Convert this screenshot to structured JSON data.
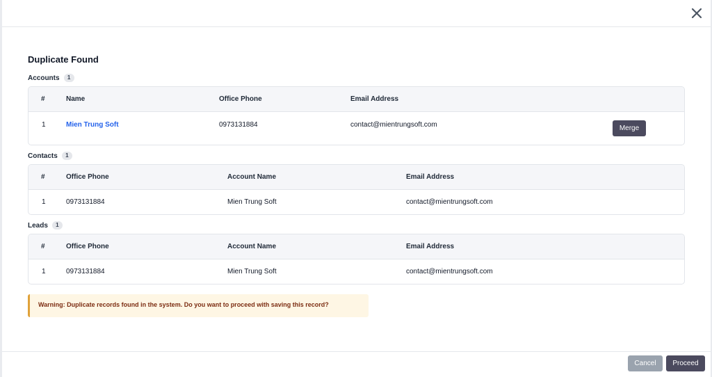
{
  "modal": {
    "title": "Duplicate Found",
    "close_icon": "close-icon"
  },
  "accounts": {
    "label": "Accounts",
    "count": "1",
    "headers": [
      "#",
      "Name",
      "Office Phone",
      "Email Address"
    ],
    "rows": [
      {
        "num": "1",
        "name": "Mien Trung Soft",
        "office_phone": "0973131884",
        "email": "contact@mientrungsoft.com",
        "action_label": "Merge"
      }
    ]
  },
  "contacts": {
    "label": "Contacts",
    "count": "1",
    "headers": [
      "#",
      "Office Phone",
      "Account Name",
      "Email Address"
    ],
    "rows": [
      {
        "num": "1",
        "office_phone": "0973131884",
        "account_name": "Mien Trung Soft",
        "email": "contact@mientrungsoft.com"
      }
    ]
  },
  "leads": {
    "label": "Leads",
    "count": "1",
    "headers": [
      "#",
      "Office Phone",
      "Account Name",
      "Email Address"
    ],
    "rows": [
      {
        "num": "1",
        "office_phone": "0973131884",
        "account_name": "Mien Trung Soft",
        "email": "contact@mientrungsoft.com"
      }
    ]
  },
  "warning": {
    "text": "Warning: Duplicate records found in the system. Do you want to proceed with saving this record?"
  },
  "footer": {
    "cancel_label": "Cancel",
    "proceed_label": "Proceed"
  },
  "colors": {
    "primary_button": "#4b4a5e",
    "cancel_button": "#9aa3ae",
    "link": "#2563eb",
    "warning_bg": "#fef6e4",
    "warning_border": "#e0a23a"
  }
}
